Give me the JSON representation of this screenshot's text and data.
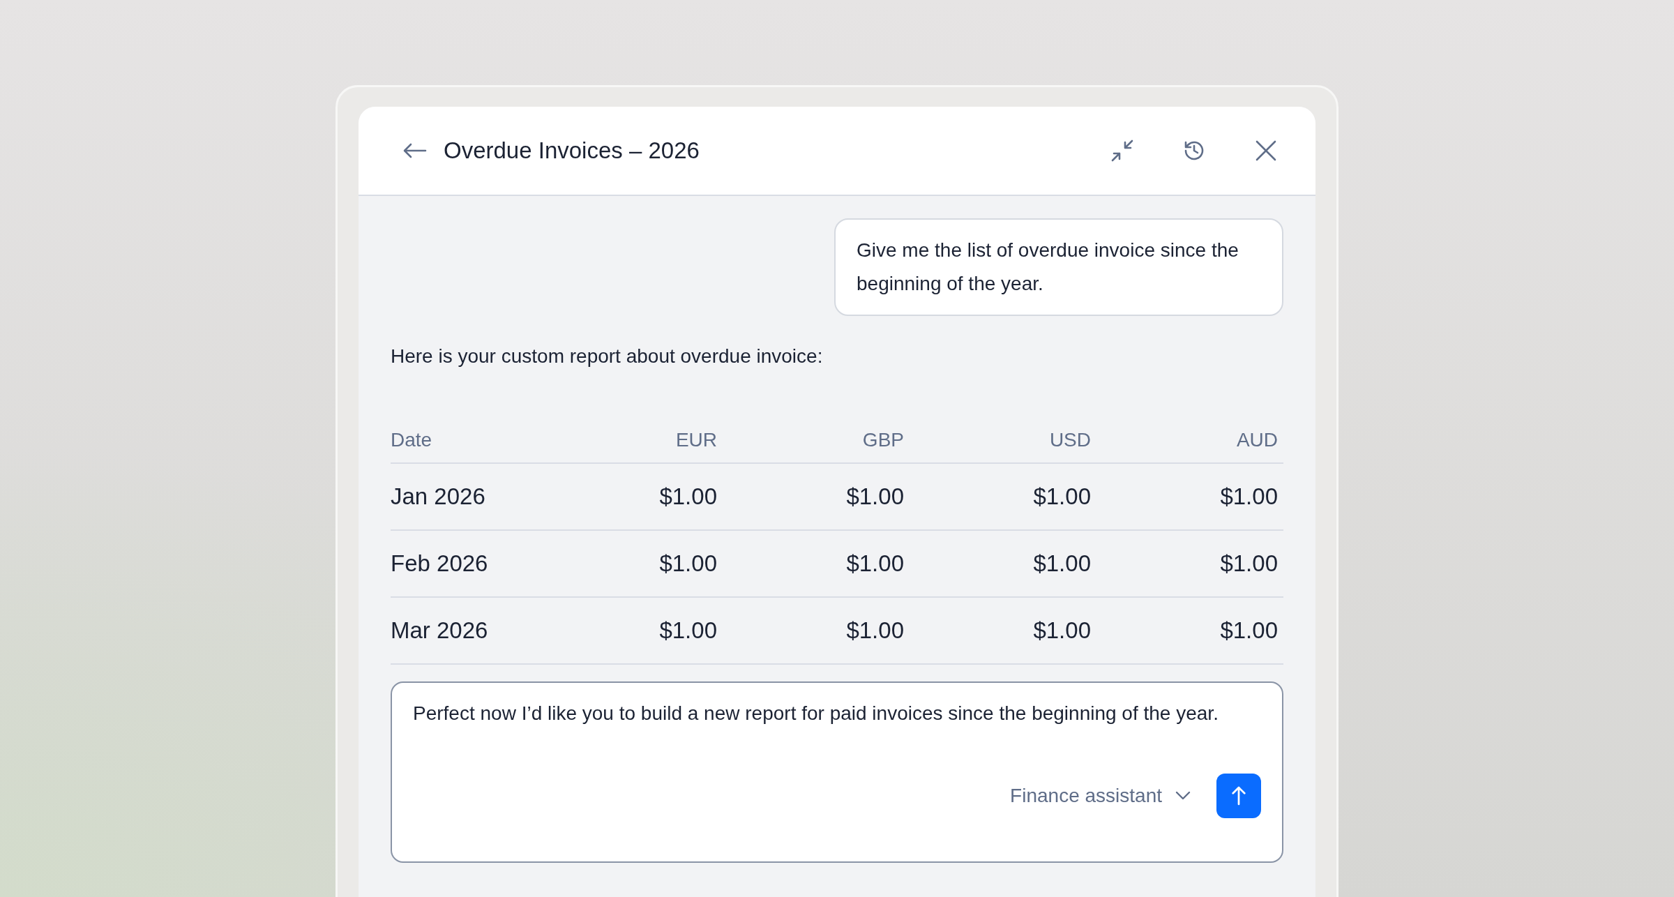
{
  "header": {
    "title": "Overdue Invoices – 2026"
  },
  "messages": [
    {
      "kind": "user",
      "text": "Give me the list of overdue invoice since the beginning of the year."
    },
    {
      "kind": "assistant",
      "text": "Here is your custom report about overdue invoice:"
    }
  ],
  "table": {
    "columns": [
      "Date",
      "EUR",
      "GBP",
      "USD",
      "AUD"
    ],
    "rows": [
      [
        "Jan 2026",
        "$1.00",
        "$1.00",
        "$1.00",
        "$1.00"
      ],
      [
        "Feb 2026",
        "$1.00",
        "$1.00",
        "$1.00",
        "$1.00"
      ],
      [
        "Mar 2026",
        "$1.00",
        "$1.00",
        "$1.00",
        "$1.00"
      ]
    ]
  },
  "composer": {
    "value": "Perfect now I’d like you to build a new report for paid invoices since the beginning of the year.",
    "assistant": "Finance assistant"
  }
}
